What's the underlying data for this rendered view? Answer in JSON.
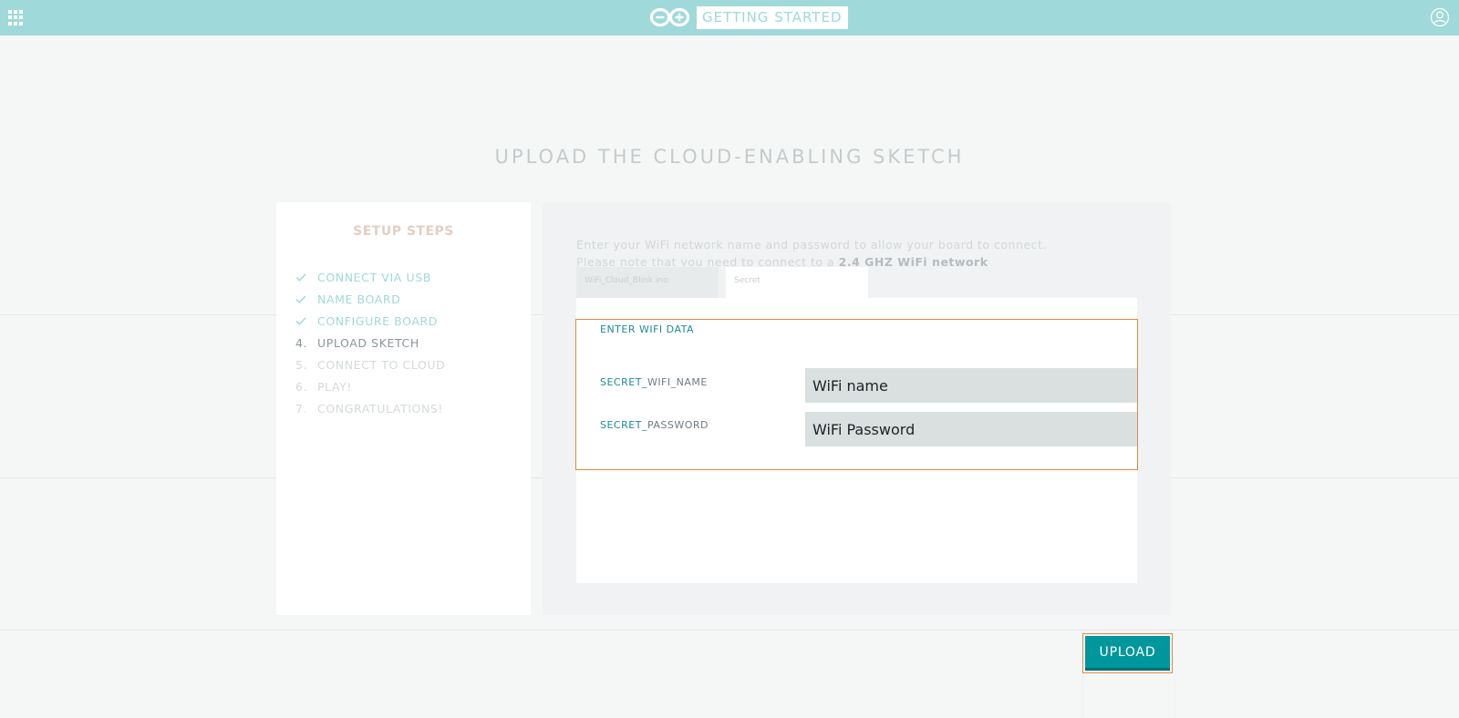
{
  "header": {
    "title": "GETTING STARTED",
    "apps_icon": "grid-icon",
    "logo_icon": "arduino-infinity-logo",
    "user_icon": "user-avatar-icon"
  },
  "page": {
    "title": "UPLOAD THE CLOUD-ENABLING SKETCH"
  },
  "steps": {
    "title": "SETUP STEPS",
    "items": [
      {
        "marker": "",
        "label": "CONNECT VIA USB",
        "state": "done"
      },
      {
        "marker": "",
        "label": "NAME BOARD",
        "state": "done"
      },
      {
        "marker": "",
        "label": "CONFIGURE BOARD",
        "state": "done"
      },
      {
        "marker": "4.",
        "label": "UPLOAD SKETCH",
        "state": "current"
      },
      {
        "marker": "5.",
        "label": "CONNECT TO CLOUD",
        "state": "todo"
      },
      {
        "marker": "6.",
        "label": "PLAY!",
        "state": "todo"
      },
      {
        "marker": "7.",
        "label": "CONGRATULATIONS!",
        "state": "todo"
      }
    ]
  },
  "intro": {
    "line1": "Enter your WiFi network name and password to allow your board to connect.",
    "line2_prefix": "Please note that you need to connect to a ",
    "line2_bold": "2.4 GHZ WiFi network"
  },
  "tabs": {
    "sketch": "WiFi_Cloud_Blink.ino",
    "secret": "Secret"
  },
  "wifi_form": {
    "title": "ENTER WIFI DATA",
    "name_label_prefix": "SECRET_",
    "name_label_rest": "WIFI_NAME",
    "name_placeholder": "WiFi name",
    "password_label_prefix": "SECRET_",
    "password_label_rest": "PASSWORD",
    "password_placeholder": "WiFi Password"
  },
  "actions": {
    "upload_label": "UPLOAD"
  },
  "colors": {
    "header_bg": "#9fd9d9",
    "accent_teal": "#00979c",
    "highlight_orange": "#e38a3d",
    "label_teal": "#1e8b98"
  }
}
